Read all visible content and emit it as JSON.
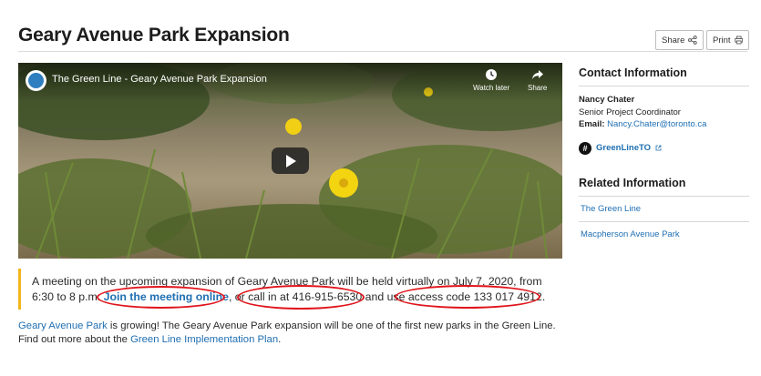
{
  "page": {
    "title": "Geary Avenue Park Expansion"
  },
  "toolbar": {
    "share_label": "Share",
    "print_label": "Print"
  },
  "video": {
    "title": "The Green Line - Geary Avenue Park Expansion",
    "watch_later_label": "Watch later",
    "share_label": "Share"
  },
  "notice": {
    "text_1": "A meeting on the upcoming expansion of Geary Avenue Park will be held virtually on July 7, 2020, from 6:30 to 8 p.m. ",
    "join_link": "Join the meeting online",
    "text_2": ", or ",
    "call_text": "call in at 416-915-6530",
    "text_3": " and use ",
    "access_text": "access code 133 017 4912."
  },
  "intro": {
    "link_1": "Geary Avenue Park",
    "text_1": " is growing! The Geary Avenue Park expansion will be one of the first new parks in the Green Line. Find out more about the ",
    "link_2": "Green Line Implementation Plan",
    "text_2": "."
  },
  "sidebar": {
    "contact_heading": "Contact Information",
    "contact_name": "Nancy Chater",
    "contact_role": "Senior Project Coordinator",
    "email_label": "Email: ",
    "email": "Nancy.Chater@toronto.ca",
    "social_handle": "GreenLineTO",
    "related_heading": "Related Information",
    "related_links": [
      "The Green Line",
      "Macpherson Avenue Park"
    ]
  },
  "colors": {
    "link": "#1f6fb2",
    "notice_bar": "#f2b51c",
    "annotation": "#e0141b"
  }
}
